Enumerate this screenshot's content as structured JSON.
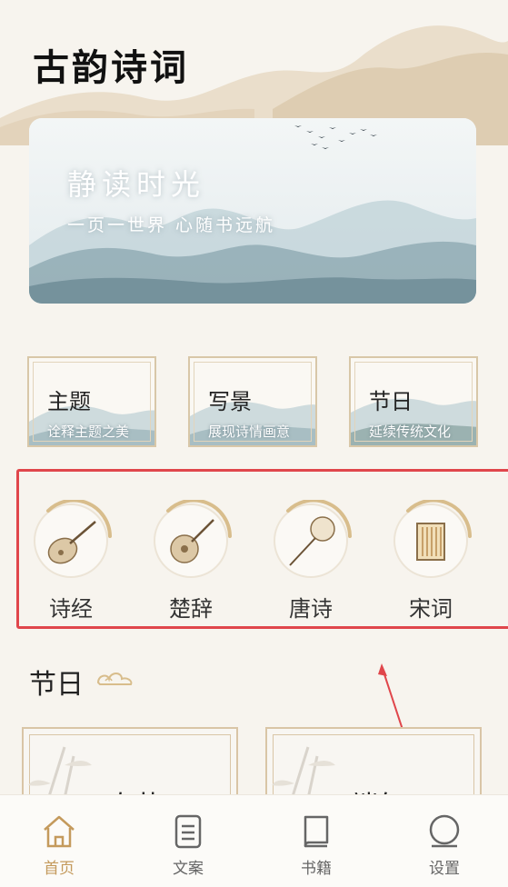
{
  "app": {
    "title": "古韵诗词"
  },
  "hero": {
    "title": "静读时光",
    "subtitle": "一页一世界 心随书远航"
  },
  "categories": [
    {
      "title": "主题",
      "subtitle": "诠释主题之美"
    },
    {
      "title": "写景",
      "subtitle": "展现诗情画意"
    },
    {
      "title": "节日",
      "subtitle": "延续传统文化"
    }
  ],
  "classics": [
    {
      "label": "诗经",
      "icon": "pipa-icon"
    },
    {
      "label": "楚辞",
      "icon": "ruan-icon"
    },
    {
      "label": "唐诗",
      "icon": "fan-icon"
    },
    {
      "label": "宋词",
      "icon": "book-scroll-icon"
    }
  ],
  "festival_section": {
    "title": "节日"
  },
  "festivals": [
    {
      "name": "春节"
    },
    {
      "name": "端午"
    }
  ],
  "tabbar": {
    "items": [
      {
        "label": "首页",
        "icon": "home-icon",
        "active": true
      },
      {
        "label": "文案",
        "icon": "document-icon",
        "active": false
      },
      {
        "label": "书籍",
        "icon": "book-icon",
        "active": false
      },
      {
        "label": "设置",
        "icon": "settings-icon",
        "active": false
      }
    ]
  },
  "colors": {
    "accent": "#c49a5c",
    "highlight_box": "#e0464b",
    "card_border": "#d8c7a8",
    "background": "#f7f4ee"
  }
}
